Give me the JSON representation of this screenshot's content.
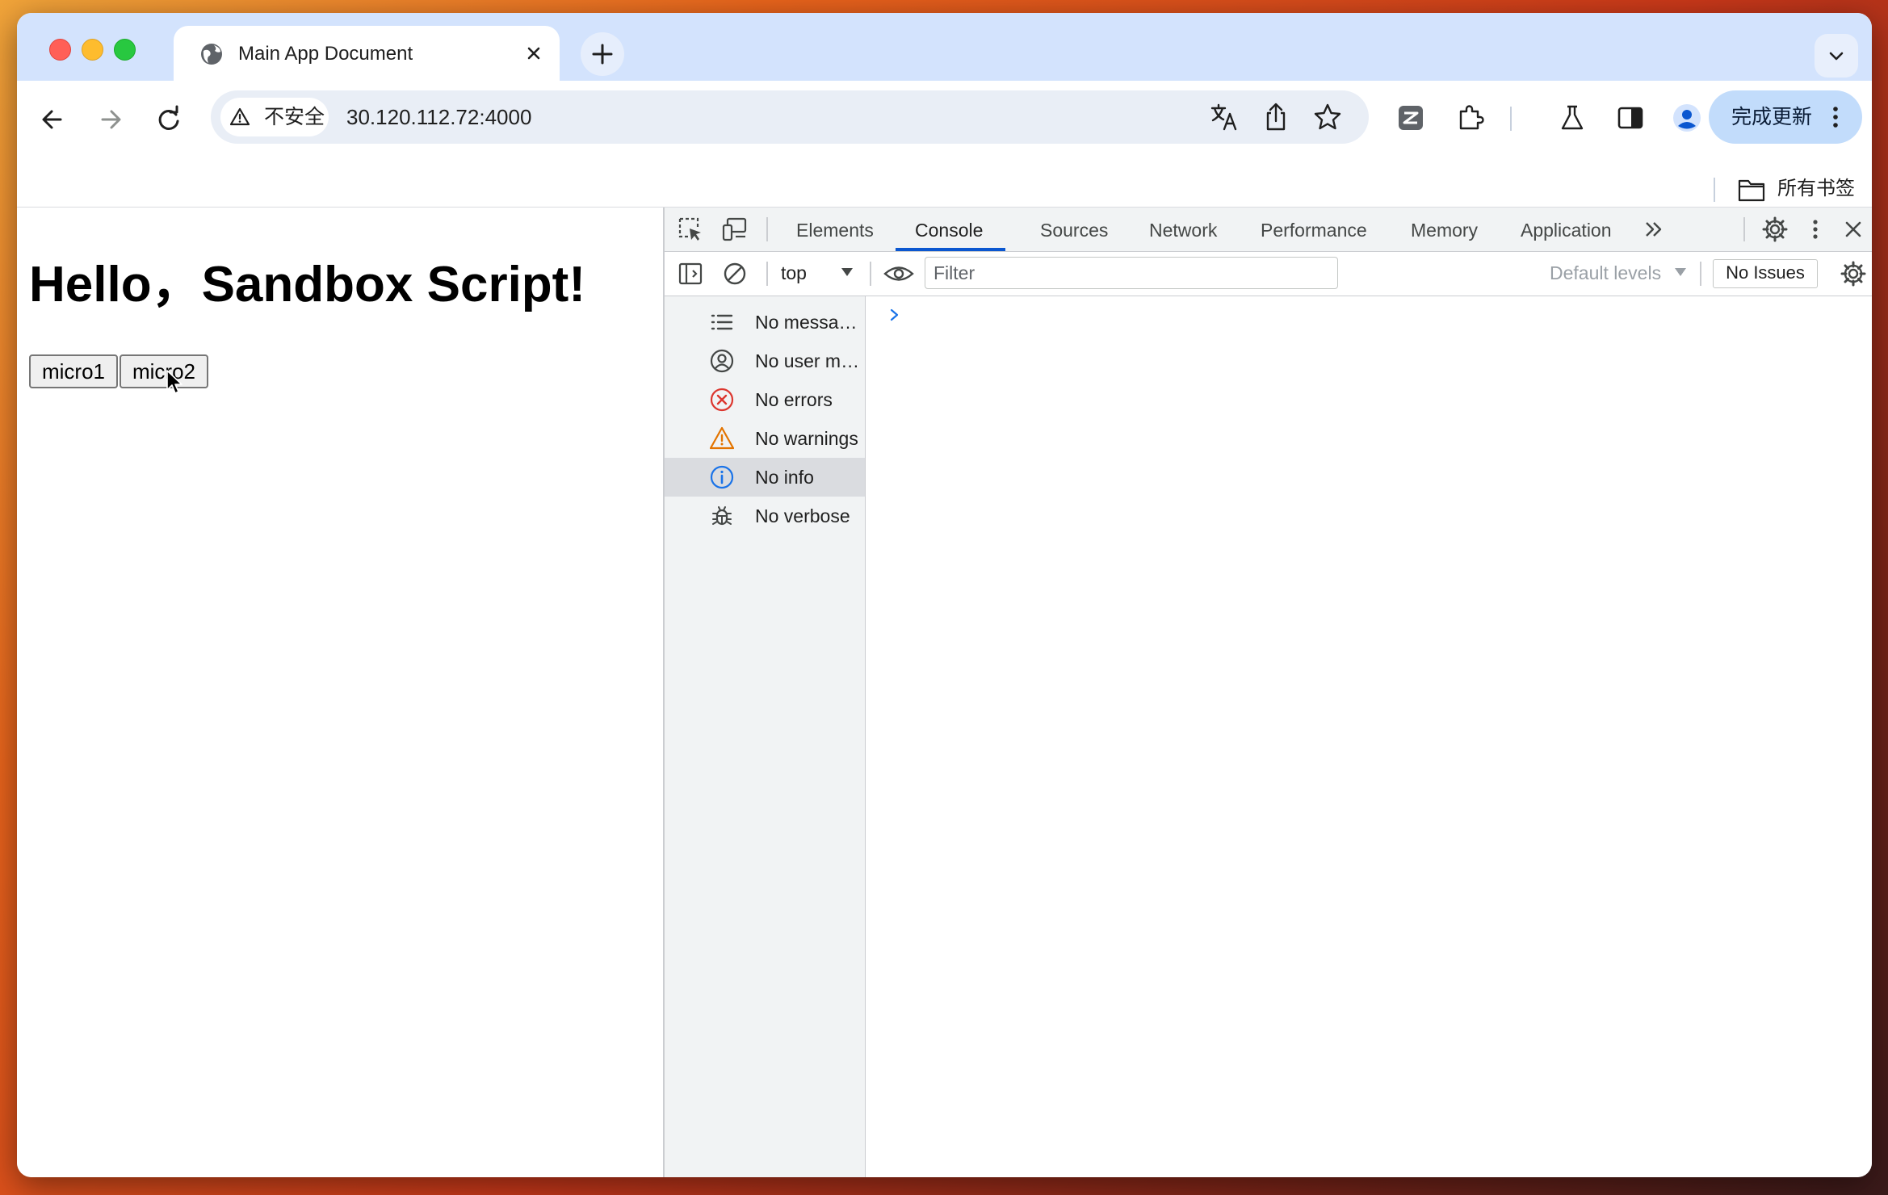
{
  "browser": {
    "tab": {
      "title": "Main App Document"
    },
    "security_label": "不安全",
    "url": "30.120.112.72:4000",
    "update_button_label": "完成更新",
    "bookmarks_label": "所有书签"
  },
  "page": {
    "heading": "Hello，Sandbox Script!",
    "buttons": [
      {
        "label": "micro1"
      },
      {
        "label": "micro2"
      }
    ]
  },
  "devtools": {
    "tabs": [
      {
        "label": "Elements"
      },
      {
        "label": "Console"
      },
      {
        "label": "Sources"
      },
      {
        "label": "Network"
      },
      {
        "label": "Performance"
      },
      {
        "label": "Memory"
      },
      {
        "label": "Application"
      }
    ],
    "active_tab": "Console",
    "context": "top",
    "filter_placeholder": "Filter",
    "levels_label": "Default levels",
    "issues_label": "No Issues",
    "sidebar": [
      {
        "label": "No messa…",
        "icon": "list-icon"
      },
      {
        "label": "No user m…",
        "icon": "user-icon"
      },
      {
        "label": "No errors",
        "icon": "error-icon"
      },
      {
        "label": "No warnings",
        "icon": "warning-icon"
      },
      {
        "label": "No info",
        "icon": "info-icon",
        "selected": true
      },
      {
        "label": "No verbose",
        "icon": "bug-icon"
      }
    ]
  },
  "colors": {
    "accent": "#0b57d0",
    "tabstrip": "#d3e3fd",
    "error": "#dc362e",
    "warning": "#e37400",
    "info": "#1a73e8"
  }
}
